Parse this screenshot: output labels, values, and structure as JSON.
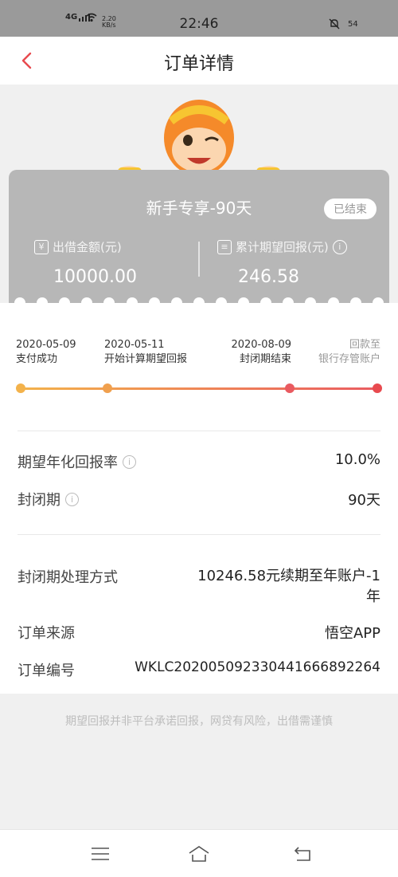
{
  "status_bar": {
    "network": "4G",
    "speed_value": "2.20",
    "speed_unit": "KB/s",
    "time": "22:46",
    "battery": "54"
  },
  "nav": {
    "title": "订单详情"
  },
  "card": {
    "product_name": "新手专享-90天",
    "status_badge": "已结束",
    "principal_label": "出借金额(元)",
    "principal_value": "10000.00",
    "return_label": "累计期望回报(元)",
    "return_value": "246.58"
  },
  "timeline": [
    {
      "date": "2020-05-09",
      "label": "支付成功"
    },
    {
      "date": "2020-05-11",
      "label": "开始计算期望回报"
    },
    {
      "date": "2020-08-09",
      "label": "封闭期结束"
    },
    {
      "date": "回款至",
      "label": "银行存管账户"
    }
  ],
  "details": {
    "rate_label": "期望年化回报率",
    "rate_value": "10.0%",
    "lock_label": "封闭期",
    "lock_value": "90天",
    "handling_label": "封闭期处理方式",
    "handling_value": "10246.58元续期至年账户-1年",
    "source_label": "订单来源",
    "source_value": "悟空APP",
    "order_no_label": "订单编号",
    "order_no_value": "WKLC2020050923304416668922​64"
  },
  "disclaimer": "期望回报并非平台承诺回报，网贷有风险，出借需谨慎",
  "colors": {
    "accent_red": "#e84a4f",
    "accent_orange": "#f3b24b",
    "card_grey": "#b7b7b7"
  },
  "icons": [
    "back-arrow-icon",
    "info-icon",
    "menu-icon",
    "home-icon",
    "return-icon"
  ]
}
